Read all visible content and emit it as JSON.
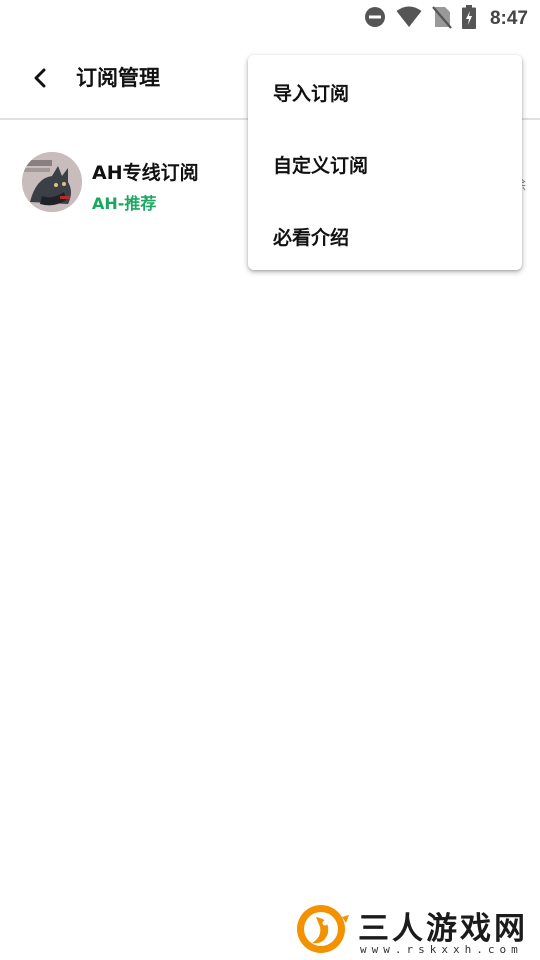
{
  "status_bar": {
    "time": "8:47",
    "icons": [
      "do-not-disturb-icon",
      "wifi-icon",
      "no-sim-icon",
      "battery-charging-icon"
    ]
  },
  "toolbar": {
    "back_icon": "back-arrow-icon",
    "title": "订阅管理"
  },
  "subscription": {
    "name": "AH专线订阅",
    "tag": "AH-推荐",
    "tag_color": "#1aa860",
    "trailing_text": "除"
  },
  "popup_menu": {
    "items": [
      {
        "label": "导入订阅"
      },
      {
        "label": "自定义订阅"
      },
      {
        "label": "必看介绍"
      }
    ]
  },
  "watermark": {
    "text": "三人游戏网",
    "url": "www.rskxxh.com",
    "logo_color": "#f39200"
  }
}
